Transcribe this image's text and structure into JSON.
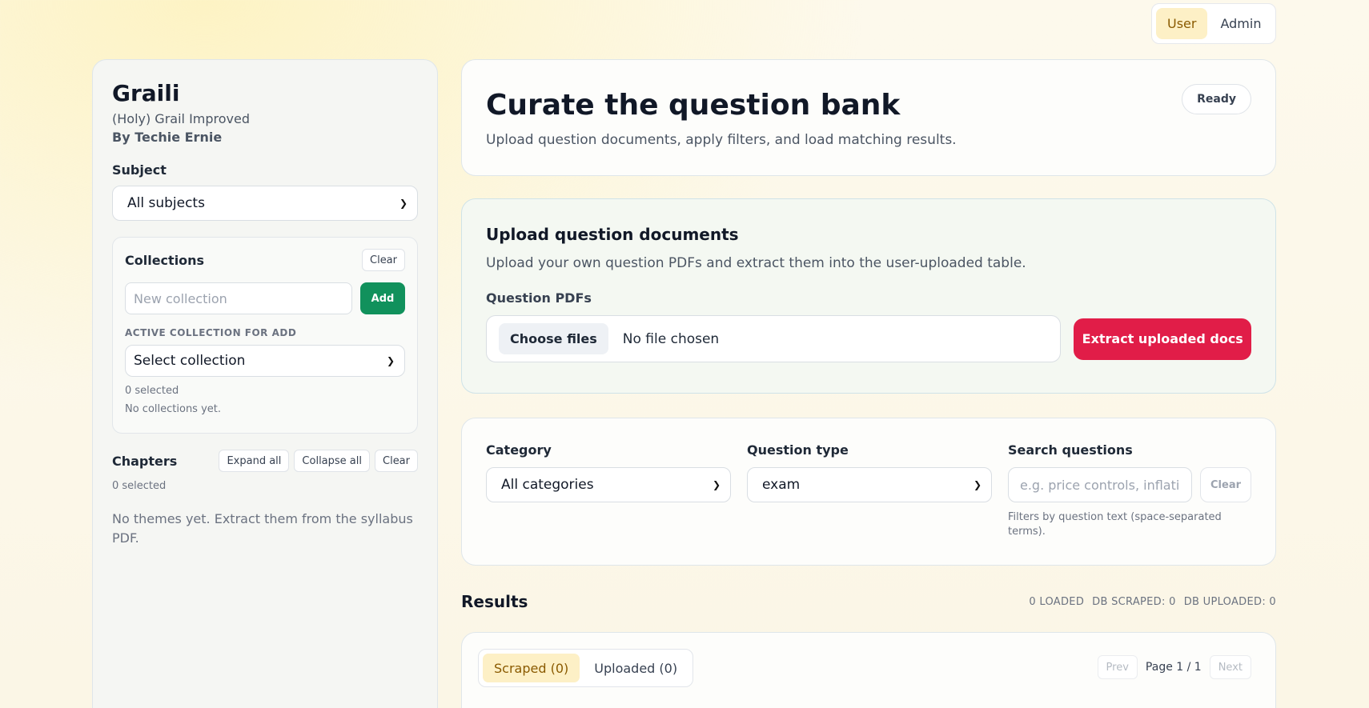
{
  "mode_toggle": {
    "user": "User",
    "admin": "Admin"
  },
  "sidebar": {
    "brand_title": "Graili",
    "brand_subtitle": "(Holy) Grail Improved",
    "brand_author": "By Techie Ernie",
    "subject_label": "Subject",
    "subject_value": "All subjects",
    "collections": {
      "title": "Collections",
      "clear": "Clear",
      "new_placeholder": "New collection",
      "add": "Add",
      "active_label": "ACTIVE COLLECTION FOR ADD",
      "select_value": "Select collection",
      "selected_count": "0 selected",
      "empty": "No collections yet."
    },
    "chapters": {
      "title": "Chapters",
      "expand_all": "Expand all",
      "collapse_all": "Collapse all",
      "clear": "Clear",
      "selected_count": "0 selected",
      "empty": "No themes yet. Extract them from the syllabus PDF."
    }
  },
  "hero": {
    "title": "Curate the question bank",
    "subtitle": "Upload question documents, apply filters, and load matching results.",
    "status": "Ready"
  },
  "upload": {
    "title": "Upload question documents",
    "description": "Upload your own question PDFs and extract them into the user-uploaded table.",
    "pdf_label": "Question PDFs",
    "choose_files": "Choose files",
    "no_file": "No file chosen",
    "extract": "Extract uploaded docs"
  },
  "filters": {
    "category_label": "Category",
    "category_value": "All categories",
    "type_label": "Question type",
    "type_value": "exam",
    "search_label": "Search questions",
    "search_placeholder": "e.g. price controls, inflati",
    "clear": "Clear",
    "hint": "Filters by question text (space-separated terms)."
  },
  "results": {
    "title": "Results",
    "loaded": "0 LOADED",
    "db_scraped": "DB SCRAPED: 0",
    "db_uploaded": "DB UPLOADED: 0",
    "tab_scraped": "Scraped (0)",
    "tab_uploaded": "Uploaded (0)",
    "prev": "Prev",
    "page": "Page 1 / 1",
    "next": "Next"
  }
}
